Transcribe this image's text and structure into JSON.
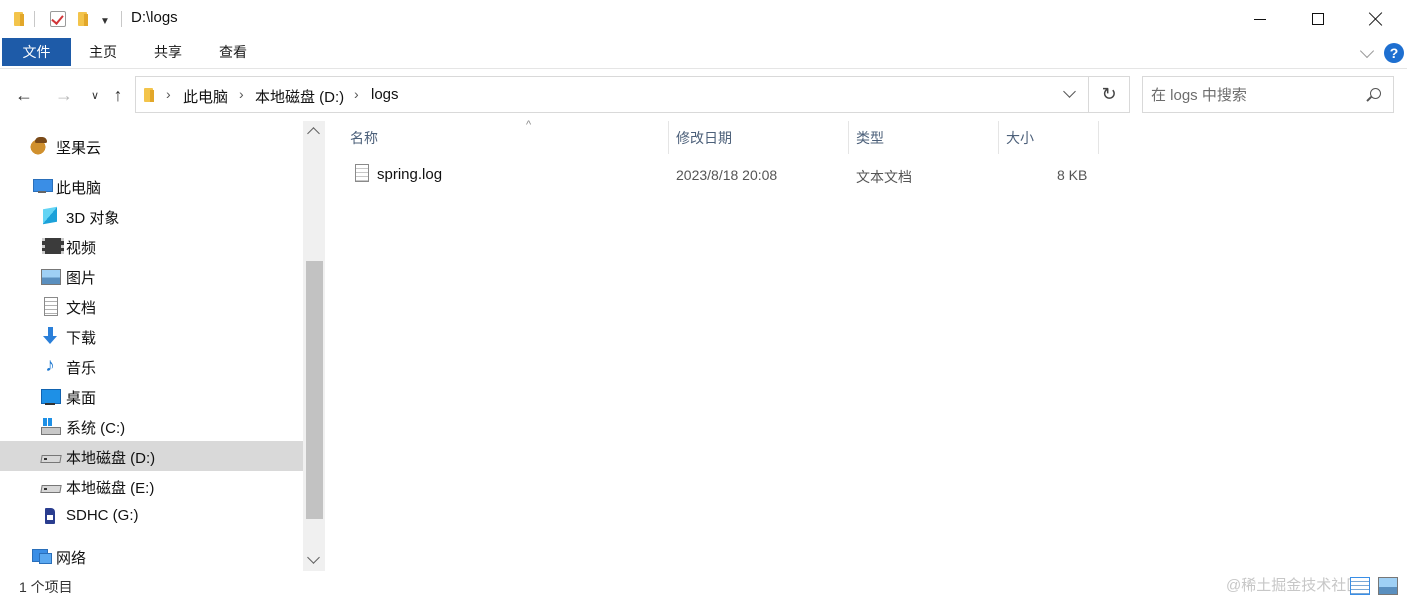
{
  "window": {
    "title": "D:\\logs",
    "controls": {
      "minimize": "minimize",
      "maximize": "maximize",
      "close": "close"
    }
  },
  "ribbon": {
    "tabs": [
      "文件",
      "主页",
      "共享",
      "查看"
    ],
    "help": "?"
  },
  "nav": {
    "breadcrumb": [
      "此电脑",
      "本地磁盘 (D:)",
      "logs"
    ],
    "search_placeholder": "在 logs 中搜索"
  },
  "sidebar": {
    "items": [
      {
        "label": "坚果云",
        "icon": "nut-icon"
      },
      {
        "label": "此电脑",
        "icon": "this-pc-icon"
      },
      {
        "label": "3D 对象",
        "icon": "3d-objects-icon"
      },
      {
        "label": "视频",
        "icon": "video-icon"
      },
      {
        "label": "图片",
        "icon": "picture-icon"
      },
      {
        "label": "文档",
        "icon": "document-icon"
      },
      {
        "label": "下载",
        "icon": "download-icon"
      },
      {
        "label": "音乐",
        "icon": "music-icon"
      },
      {
        "label": "桌面",
        "icon": "desktop-icon"
      },
      {
        "label": "系统 (C:)",
        "icon": "system-drive-icon"
      },
      {
        "label": "本地磁盘 (D:)",
        "icon": "drive-icon",
        "selected": true
      },
      {
        "label": "本地磁盘 (E:)",
        "icon": "drive-icon"
      },
      {
        "label": "SDHC (G:)",
        "icon": "sd-card-icon"
      },
      {
        "label": "网络",
        "icon": "network-icon"
      }
    ]
  },
  "file_list": {
    "columns": [
      "名称",
      "修改日期",
      "类型",
      "大小"
    ],
    "rows": [
      {
        "name": "spring.log",
        "modified": "2023/8/18 20:08",
        "type": "文本文档",
        "size": "8 KB"
      }
    ]
  },
  "status": {
    "item_count": "1 个项目",
    "watermark": "@稀土掘金技术社区"
  },
  "colors": {
    "file_tab_bg": "#1e5ba8",
    "selected_bg": "#d9d9d9",
    "column_header_text": "#4c607a"
  }
}
